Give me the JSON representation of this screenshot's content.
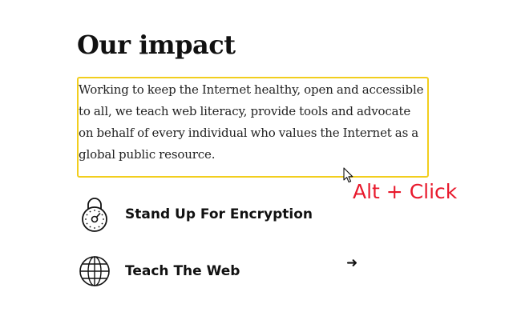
{
  "section": {
    "title": "Our impact",
    "intro": "Working to keep the Internet healthy, open and accessible to all, we teach web literacy, provide tools and advocate on behalf of every individual who values the Internet as a global public resource."
  },
  "hint": {
    "text": "Alt + Click",
    "color": "#e8192c"
  },
  "focus_outline_color": "#f2ce1e",
  "impact_items": [
    {
      "label": "Stand Up For Encryption",
      "icon": "padlock-icon"
    },
    {
      "label": "Teach The Web",
      "icon": "globe-icon",
      "arrow": "➜"
    }
  ]
}
